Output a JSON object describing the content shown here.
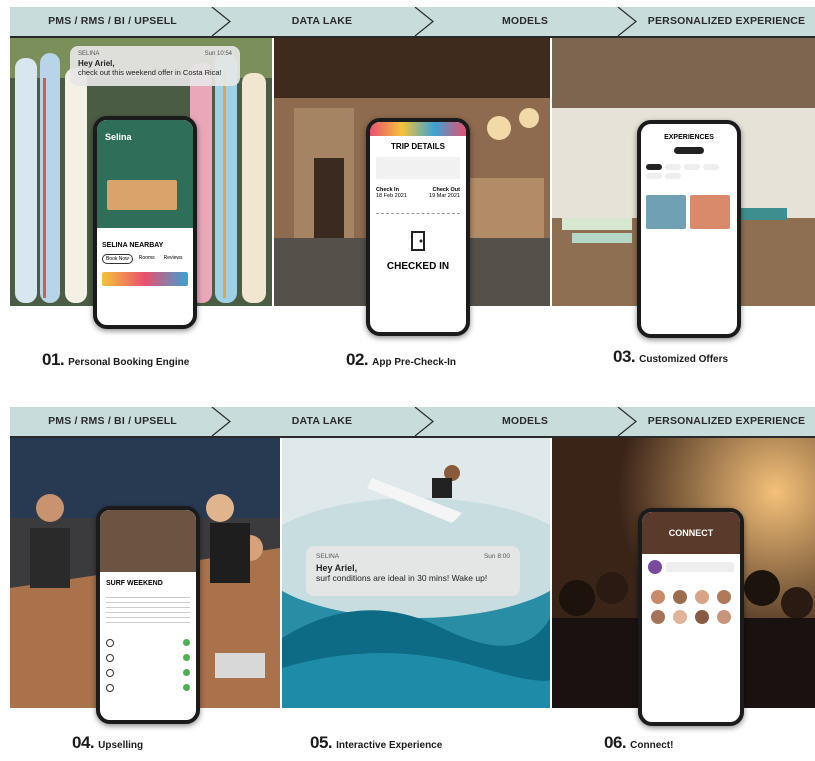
{
  "pipeline_steps": [
    "PMS / RMS / BI / UPSELL",
    "DATA LAKE",
    "MODELS",
    "PERSONALIZED EXPERIENCE"
  ],
  "captions": [
    {
      "num": "01.",
      "text": "Personal Booking Engine"
    },
    {
      "num": "02.",
      "text": "App Pre-Check-In"
    },
    {
      "num": "03.",
      "text": "Customized Offers"
    },
    {
      "num": "04.",
      "text": "Upselling"
    },
    {
      "num": "05.",
      "text": "Interactive Experience"
    },
    {
      "num": "06.",
      "text": "Connect!"
    }
  ],
  "notification_1": {
    "app": "SELINA",
    "time": "Sun 10:54",
    "title": "Hey Ariel,",
    "body": "check out this weekend offer in Costa Rica!"
  },
  "notification_2": {
    "app": "SELINA",
    "time": "Sun 8:00",
    "title": "Hey Ariel,",
    "body": "surf conditions are ideal in 30 mins! Wake up!"
  },
  "phone_1": {
    "title": "Selina",
    "brand": "SELINA NEARBAY",
    "tab1": "Book Now",
    "tab2": "Rooms",
    "tab3": "Reviews"
  },
  "phone_2": {
    "title": "TRIP DETAILS",
    "checkin_label": "Check In",
    "checkin_date": "18 Feb 2021",
    "checkout_label": "Check Out",
    "checkout_date": "19 Mar 2021",
    "status": "CHECKED IN"
  },
  "phone_3": {
    "title": "EXPERIENCES"
  },
  "phone_4": {
    "title": "SURF WEEKEND"
  },
  "phone_6": {
    "title": "CONNECT"
  }
}
